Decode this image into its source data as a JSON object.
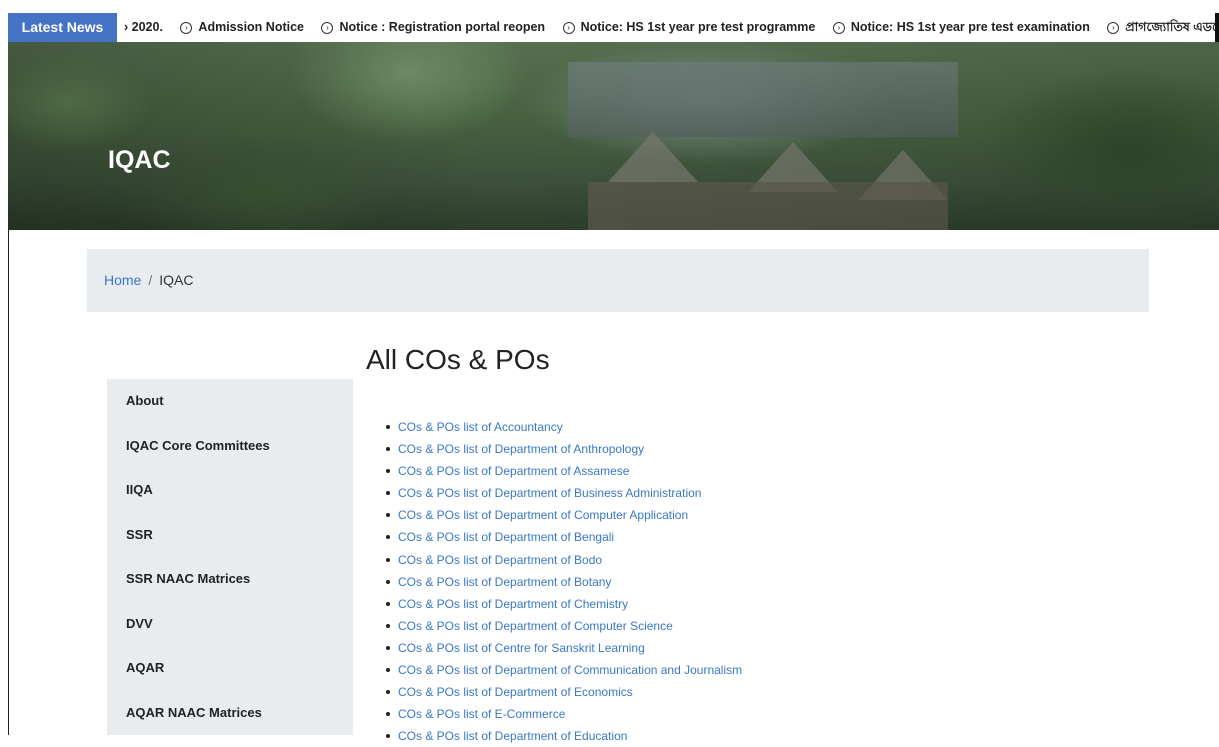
{
  "ticker": {
    "label": "Latest News",
    "items": [
      "2020.",
      "Admission Notice",
      "Notice : Registration portal reopen",
      "Notice: HS 1st year pre test programme",
      "Notice: HS 1st year pre test examination",
      "প্ৰাগজ্যোতিষ এডভেঞ্চাৰ"
    ]
  },
  "banner": {
    "title": "IQAC"
  },
  "breadcrumb": {
    "home": "Home",
    "separator": "/",
    "current": "IQAC"
  },
  "sidebar": {
    "items": [
      "About",
      "IQAC Core Committees",
      "IIQA",
      "SSR",
      "SSR NAAC Matrices",
      "DVV",
      "AQAR",
      "AQAR NAAC Matrices"
    ]
  },
  "main": {
    "title": "All COs & POs",
    "links": [
      "COs & POs list of Accountancy",
      "COs & POs list of Department of Anthropology",
      "COs & POs list of Department of Assamese",
      "COs & POs list of Department of Business Administration",
      "COs & POs list of Department of Computer Application",
      "COs & POs list of Department of Bengali",
      "COs & POs list of Department of Bodo",
      "COs & POs list of Department of Botany",
      "COs & POs list of Department of Chemistry",
      "COs & POs list of Department of Computer Science",
      "COs & POs list of Centre for Sanskrit Learning",
      "COs & POs list of Department of Communication and Journalism",
      "COs & POs list of Department of Economics",
      "COs & POs list of E-Commerce",
      "COs & POs list of Department of Education"
    ]
  }
}
